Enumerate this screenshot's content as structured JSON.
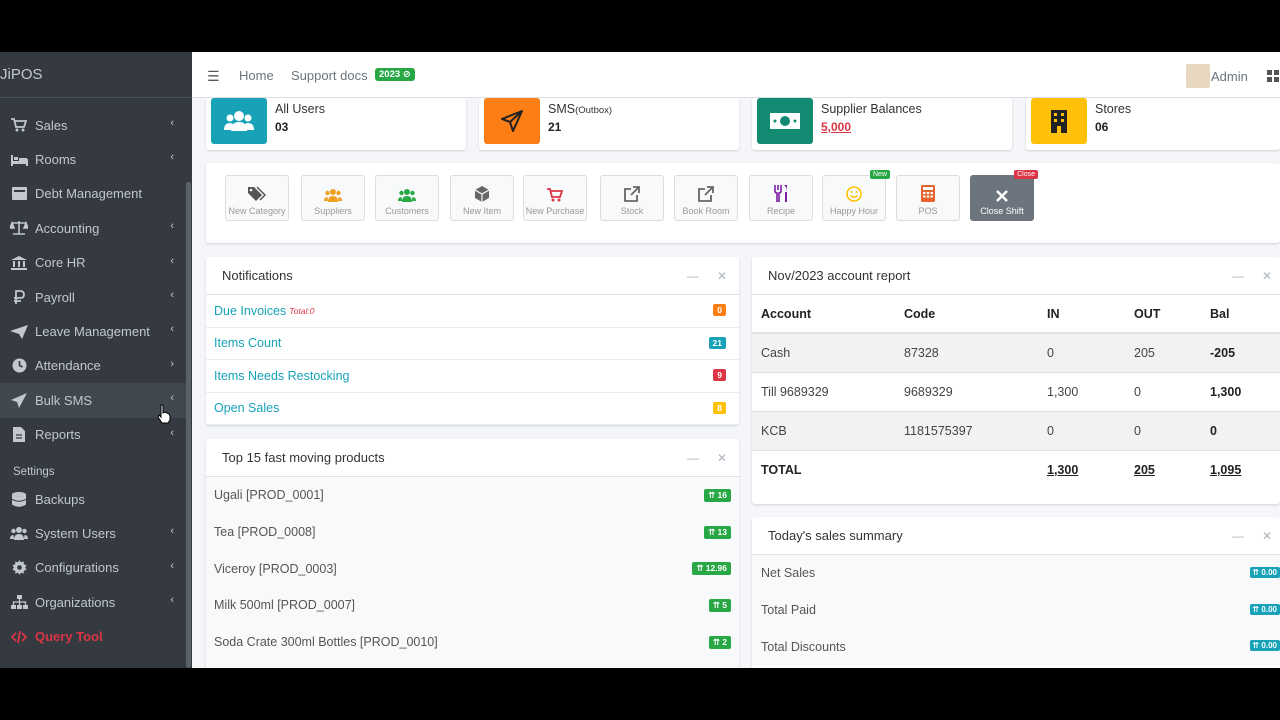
{
  "brand": "JiPOS",
  "sidebar": {
    "items": [
      {
        "label": "Sales",
        "icon": "cart-icon",
        "chevron": "‹"
      },
      {
        "label": "Rooms",
        "icon": "bed-icon",
        "chevron": "‹"
      },
      {
        "label": "Debt Management",
        "icon": "card-icon",
        "chevron": ""
      },
      {
        "label": "Accounting",
        "icon": "scale-icon",
        "chevron": "‹"
      },
      {
        "label": "Core HR",
        "icon": "bank-icon",
        "chevron": "‹"
      },
      {
        "label": "Payroll",
        "icon": "ruble-icon",
        "chevron": "‹"
      },
      {
        "label": "Leave Management",
        "icon": "plane-icon",
        "chevron": "‹"
      },
      {
        "label": "Attendance",
        "icon": "clock-icon",
        "chevron": "›"
      },
      {
        "label": "Bulk SMS",
        "icon": "send-icon",
        "chevron": "‹"
      },
      {
        "label": "Reports",
        "icon": "file-icon",
        "chevron": "‹"
      }
    ],
    "settings_header": "Settings",
    "settings_items": [
      {
        "label": "Backups",
        "icon": "database-icon",
        "chevron": ""
      },
      {
        "label": "System Users",
        "icon": "users-icon",
        "chevron": "‹"
      },
      {
        "label": "Configurations",
        "icon": "gear-icon",
        "chevron": "‹"
      },
      {
        "label": "Organizations",
        "icon": "sitemap-icon",
        "chevron": "‹"
      }
    ],
    "query_tool": "Query Tool"
  },
  "topbar": {
    "home": "Home",
    "support": "Support docs",
    "version_badge": "2023 ⊘",
    "user": "Admin"
  },
  "infoboxes": [
    {
      "label": "All Users",
      "value": "03",
      "color": "#17a2b8",
      "icon": "users-icon"
    },
    {
      "label": "SMS",
      "label_sub": "(Outbox)",
      "value": "21",
      "color": "#fd7e14",
      "icon": "send-icon"
    },
    {
      "label": "Supplier Balances",
      "value": "5,000",
      "color": "#138a72",
      "icon": "money-icon"
    },
    {
      "label": "Stores",
      "value": "06",
      "color": "#ffc107",
      "icon": "building-icon"
    }
  ],
  "quick_actions": [
    {
      "label": "New Category",
      "icon": "tags-icon",
      "color": "#555"
    },
    {
      "label": "Suppliers",
      "icon": "users-icon",
      "color": "#f0a020"
    },
    {
      "label": "Customers",
      "icon": "users-icon",
      "color": "#28a745"
    },
    {
      "label": "New Item",
      "icon": "cube-icon",
      "color": "#666"
    },
    {
      "label": "New Purchase",
      "icon": "cart-icon",
      "color": "#dc3545"
    },
    {
      "label": "Stock",
      "icon": "external-link-icon",
      "color": "#666"
    },
    {
      "label": "Book Room",
      "icon": "external-link-icon",
      "color": "#666"
    },
    {
      "label": "Recipe",
      "icon": "utensils-icon",
      "color": "#7a1fa2"
    },
    {
      "label": "Happy Hour",
      "icon": "smile-icon",
      "color": "#ffc107",
      "badge": "New"
    },
    {
      "label": "POS",
      "icon": "calculator-icon",
      "color": "#e8622c"
    },
    {
      "label": "Close Shift",
      "icon": "close-icon",
      "color": "#fff",
      "badge": "Close"
    }
  ],
  "notifications": {
    "title": "Notifications",
    "rows": [
      {
        "label": "Due Invoices",
        "extra": "Total:0",
        "badge": "0",
        "badge_color": "#fd7e14"
      },
      {
        "label": "Items Count",
        "extra": "",
        "badge": "21",
        "badge_color": "#17a2b8"
      },
      {
        "label": "Items Needs Restocking",
        "extra": "",
        "badge": "9",
        "badge_color": "#dc3545"
      },
      {
        "label": "Open Sales",
        "extra": "",
        "badge": "8",
        "badge_color": "#ffc107"
      }
    ]
  },
  "products": {
    "title": "Top 15 fast moving products",
    "rows": [
      {
        "label": "Ugali [PROD_0001]",
        "badge": "⇈ 16"
      },
      {
        "label": "Tea [PROD_0008]",
        "badge": "⇈ 13"
      },
      {
        "label": "Viceroy [PROD_0003]",
        "badge": "⇈ 12.96"
      },
      {
        "label": "Milk 500ml [PROD_0007]",
        "badge": "⇈ 5"
      },
      {
        "label": "Soda Crate 300ml Bottles [PROD_0010]",
        "badge": "⇈ 2"
      }
    ]
  },
  "account_report": {
    "title": "Nov/2023 account report",
    "headers": [
      "Account",
      "Code",
      "IN",
      "OUT",
      "Bal"
    ],
    "rows": [
      [
        "Cash",
        "87328",
        "0",
        "205",
        "-205"
      ],
      [
        "Till 9689329",
        "9689329",
        "1,300",
        "0",
        "1,300"
      ],
      [
        "KCB",
        "1181575397",
        "0",
        "0",
        "0"
      ]
    ],
    "total": [
      "TOTAL",
      "",
      "1,300",
      "205",
      "1,095"
    ]
  },
  "sales_summary": {
    "title": "Today's sales summary",
    "rows": [
      {
        "label": "Net Sales",
        "badge": "⇈ 0.00"
      },
      {
        "label": "Total Paid",
        "badge": "⇈ 0.00"
      },
      {
        "label": "Total Discounts",
        "badge": "⇈ 0.00"
      }
    ]
  },
  "card_tools": {
    "minimize": "—",
    "close": "✕"
  }
}
